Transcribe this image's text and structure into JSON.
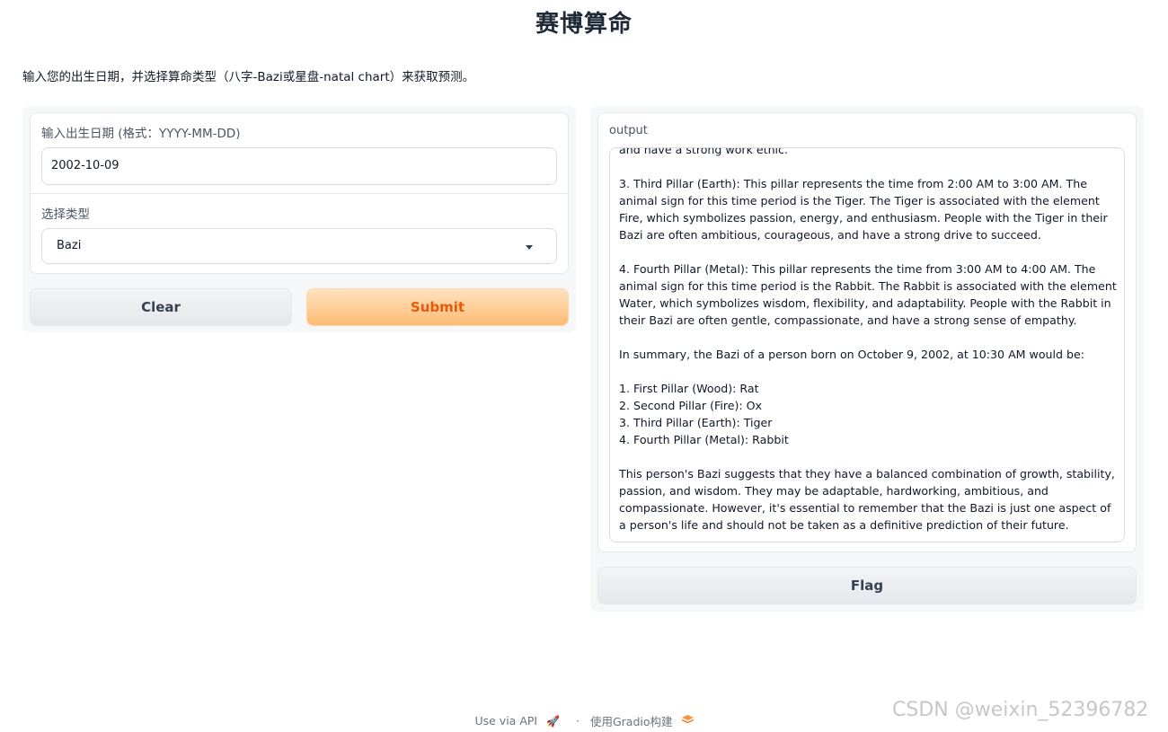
{
  "app": {
    "title": "赛博算命",
    "description": "输入您的出生日期，并选择算命类型（八字-Bazi或星盘-natal chart）来获取预测。"
  },
  "form": {
    "date_label": "输入出生日期 (格式：YYYY-MM-DD)",
    "date_value": "2002-10-09",
    "type_label": "选择类型",
    "type_selected": "Bazi",
    "clear_label": "Clear",
    "submit_label": "Submit"
  },
  "output": {
    "label": "output",
    "text": "and have a strong work ethic.\n\n3. Third Pillar (Earth): This pillar represents the time from 2:00 AM to 3:00 AM. The animal sign for this time period is the Tiger. The Tiger is associated with the element Fire, which symbolizes passion, energy, and enthusiasm. People with the Tiger in their Bazi are often ambitious, courageous, and have a strong drive to succeed.\n\n4. Fourth Pillar (Metal): This pillar represents the time from 3:00 AM to 4:00 AM. The animal sign for this time period is the Rabbit. The Rabbit is associated with the element Water, which symbolizes wisdom, flexibility, and adaptability. People with the Rabbit in their Bazi are often gentle, compassionate, and have a strong sense of empathy.\n\nIn summary, the Bazi of a person born on October 9, 2002, at 10:30 AM would be:\n\n1. First Pillar (Wood): Rat\n2. Second Pillar (Fire): Ox\n3. Third Pillar (Earth): Tiger\n4. Fourth Pillar (Metal): Rabbit\n\nThis person's Bazi suggests that they have a balanced combination of growth, stability, passion, and wisdom. They may be adaptable, hardworking, ambitious, and compassionate. However, it's essential to remember that the Bazi is just one aspect of a person's life and should not be taken as a definitive prediction of their future.",
    "flag_label": "Flag"
  },
  "footer": {
    "api_label": "Use via API",
    "api_icon": "rocket-icon",
    "separator": "·",
    "built_with": "使用Gradio构建",
    "logo_icon": "gradio-logo-icon"
  },
  "watermark": "CSDN @weixin_52396782",
  "colors": {
    "submit_text": "#ea580c",
    "submit_bg": "#fdba74",
    "panel_bg": "#f6f7f9"
  }
}
